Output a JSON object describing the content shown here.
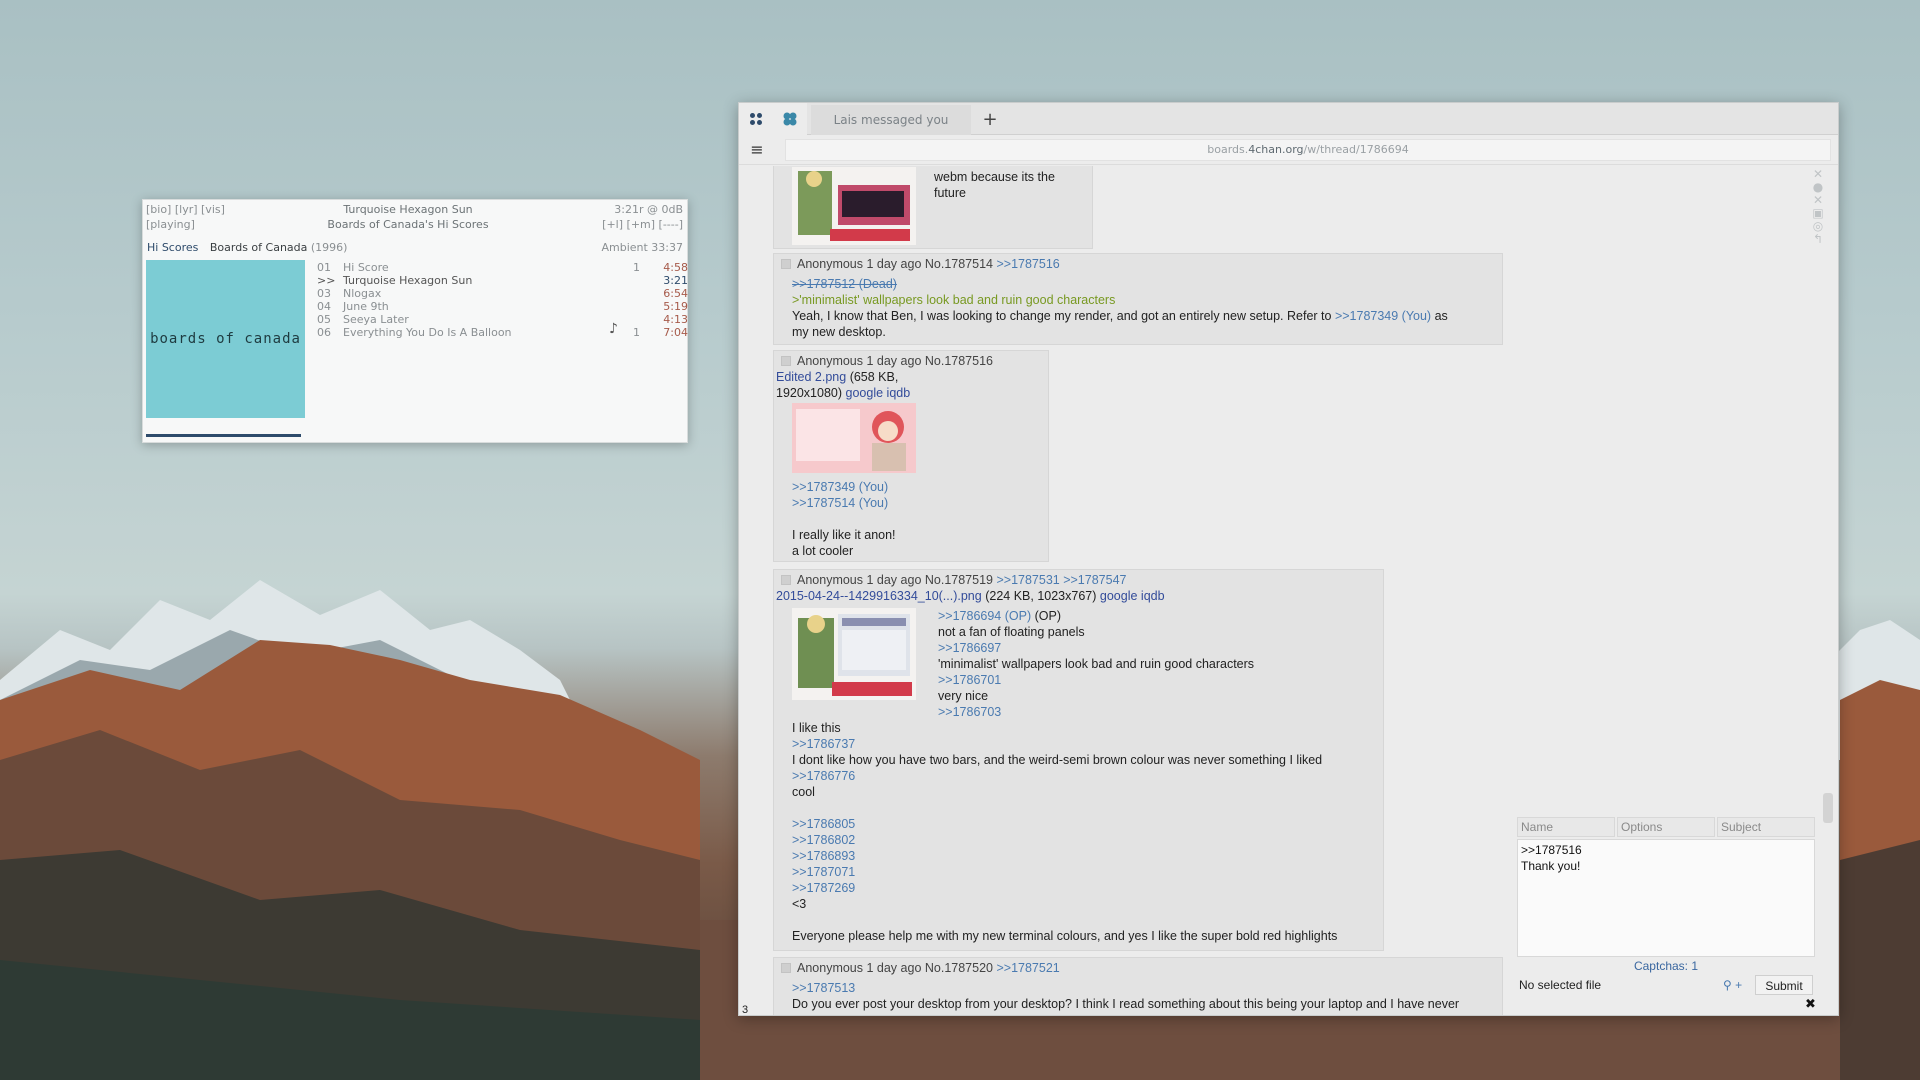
{
  "player": {
    "hdr_left_1": "[bio] [lyr] [vis]",
    "hdr_left_2": "[playing]",
    "now_title": "Turquoise Hexagon Sun",
    "now_album": "Boards of Canada's Hi Scores",
    "hdr_right_1": "3:21r @   0dB",
    "hdr_right_2": "[+l] [+m] [----]",
    "tab_active": "Hi Scores",
    "album": "Boards of Canada",
    "year": "(1996)",
    "ambient": "Ambient 33:37",
    "album_art_text": "boards of canada",
    "progress_fraction": 0.29,
    "tracks": [
      {
        "num": "01",
        "name": "Hi Score",
        "plays": "1",
        "dur": "4:58"
      },
      {
        "num": ">>",
        "name": "Turquoise Hexagon Sun",
        "plays": "",
        "dur": "3:21"
      },
      {
        "num": "03",
        "name": "Nlogax",
        "plays": "",
        "dur": "6:54"
      },
      {
        "num": "04",
        "name": "June 9th",
        "plays": "",
        "dur": "5:19"
      },
      {
        "num": "05",
        "name": "Seeya Later",
        "plays": "",
        "dur": "4:13"
      },
      {
        "num": "06",
        "name": "Everything You Do Is A Balloon",
        "plays": "1",
        "dur": "7:04"
      }
    ]
  },
  "browser": {
    "tab_title": "Lais messaged you",
    "url_host": "boards.4chan.org",
    "url_path": "/w/thread/1786694",
    "url_prefix": "boards.",
    "url_domain": "4chan.org",
    "page_number": "3"
  },
  "posts": {
    "p0": {
      "line1": "webm because its the",
      "line2": "future"
    },
    "p1": {
      "meta": "Anonymous 1 day ago No.1787514",
      "reply": ">>1787516",
      "dead": ">>1787512 (Dead)",
      "green": ">'minimalist' wallpapers look bad and ruin good characters",
      "body1": "Yeah, I know that Ben, I was looking to change my render, and got an entirely new setup. Refer to",
      "body1_link": ">>1787349 (You)",
      "body1_tail": "as",
      "body2": "my new desktop."
    },
    "p2": {
      "meta": "Anonymous 1 day ago No.1787516",
      "file": "Edited 2.png",
      "file_info": "(658 KB,",
      "file_info2": "1920x1080)",
      "google": "google",
      "iqdb": "iqdb",
      "q1": ">>1787349 (You)",
      "q2": ">>1787514 (You)",
      "body1": "I really like it anon!",
      "body2": "a lot cooler"
    },
    "p3": {
      "meta": "Anonymous 1 day ago No.1787519",
      "replies": ">>1787531 >>1787547",
      "file": "2015-04-24--1429916334_10(...).png",
      "file_info": "(224 KB, 1023x767)",
      "google": "google",
      "iqdb": "iqdb",
      "r1_link": ">>1786694 (OP)",
      "r1_tail": "(OP)",
      "r1_text": "not a fan of floating panels",
      "r2_link": ">>1786697",
      "r2_text": "'minimalist' wallpapers look bad and ruin good characters",
      "r3_link": ">>1786701",
      "r3_text": "very nice",
      "r4_link": ">>1786703",
      "r4_text": "I like this",
      "r5_link": ">>1786737",
      "r5_text": "I dont like how you have two bars, and the weird-semi brown colour was never something I liked",
      "r6_link": ">>1786776",
      "r6_text": "cool",
      "links": [
        ">>1786805",
        ">>1786802",
        ">>1786893",
        ">>1787071",
        ">>1787269"
      ],
      "heart": "<3",
      "closing": "Everyone please help me with my new terminal colours, and yes I like the super bold red highlights"
    },
    "p4": {
      "meta": "Anonymous 1 day ago No.1787520",
      "reply": ">>1787521",
      "q1": ">>1787513",
      "body1": "Do you ever post your desktop from your desktop? I think I read something about this being your laptop and I have never"
    }
  },
  "quick_reply": {
    "name_placeholder": "Name",
    "options_placeholder": "Options",
    "subject_placeholder": "Subject",
    "comment_line1": ">>1787516",
    "comment_line2": "Thank you!",
    "captchas": "Captchas: 1",
    "file_status": "No selected file",
    "submit": "Submit"
  },
  "colors": {
    "accent": "#2e4b6b",
    "quotelink": "#4a7ab0",
    "greentext": "#789922",
    "album_art": "#7cccd4"
  }
}
